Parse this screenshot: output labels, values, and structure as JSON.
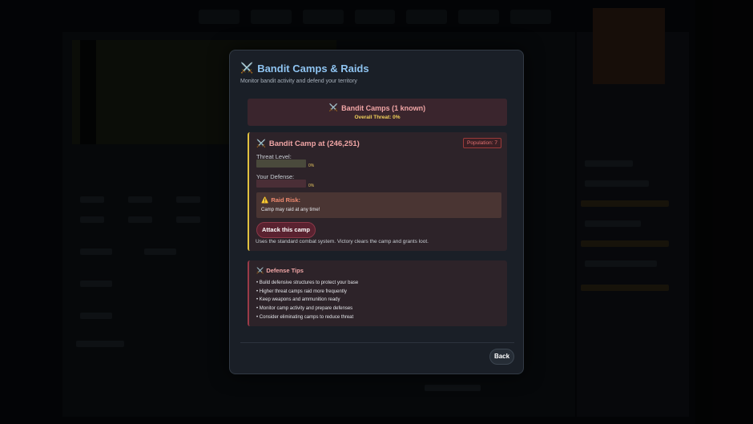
{
  "modal": {
    "icon": "⚔️",
    "title": "Bandit Camps & Raids",
    "subtitle": "Monitor bandit activity and defend your territory"
  },
  "camps_header": {
    "icon": "⚔️",
    "title": "Bandit Camps (1 known)",
    "overall_threat": "Overall Threat: 0%"
  },
  "camp": {
    "icon": "⚔️",
    "title": "Bandit Camp at (246,251)",
    "population": "Population: 7",
    "threat_label": "Threat Level:",
    "threat_pct": "0%",
    "threat_value": 0,
    "defense_label": "Your Defense:",
    "defense_pct": "0%",
    "defense_value": 0,
    "risk_icon": "⚠️",
    "risk_title": "Raid Risk:",
    "risk_text": "Camp may raid at any time!",
    "attack_label": "Attack this camp",
    "attack_note": "Uses the standard combat system. Victory clears the camp and grants loot."
  },
  "tips": {
    "icon": "⚔️",
    "title": "Defense Tips",
    "items": [
      "• Build defensive structures to protect your base",
      "• Higher threat camps raid more frequently",
      "• Keep weapons and ammunition ready",
      "• Monitor camp activity and prepare defenses",
      "• Consider eliminating camps to reduce threat"
    ]
  },
  "footer": {
    "back_label": "Back"
  }
}
